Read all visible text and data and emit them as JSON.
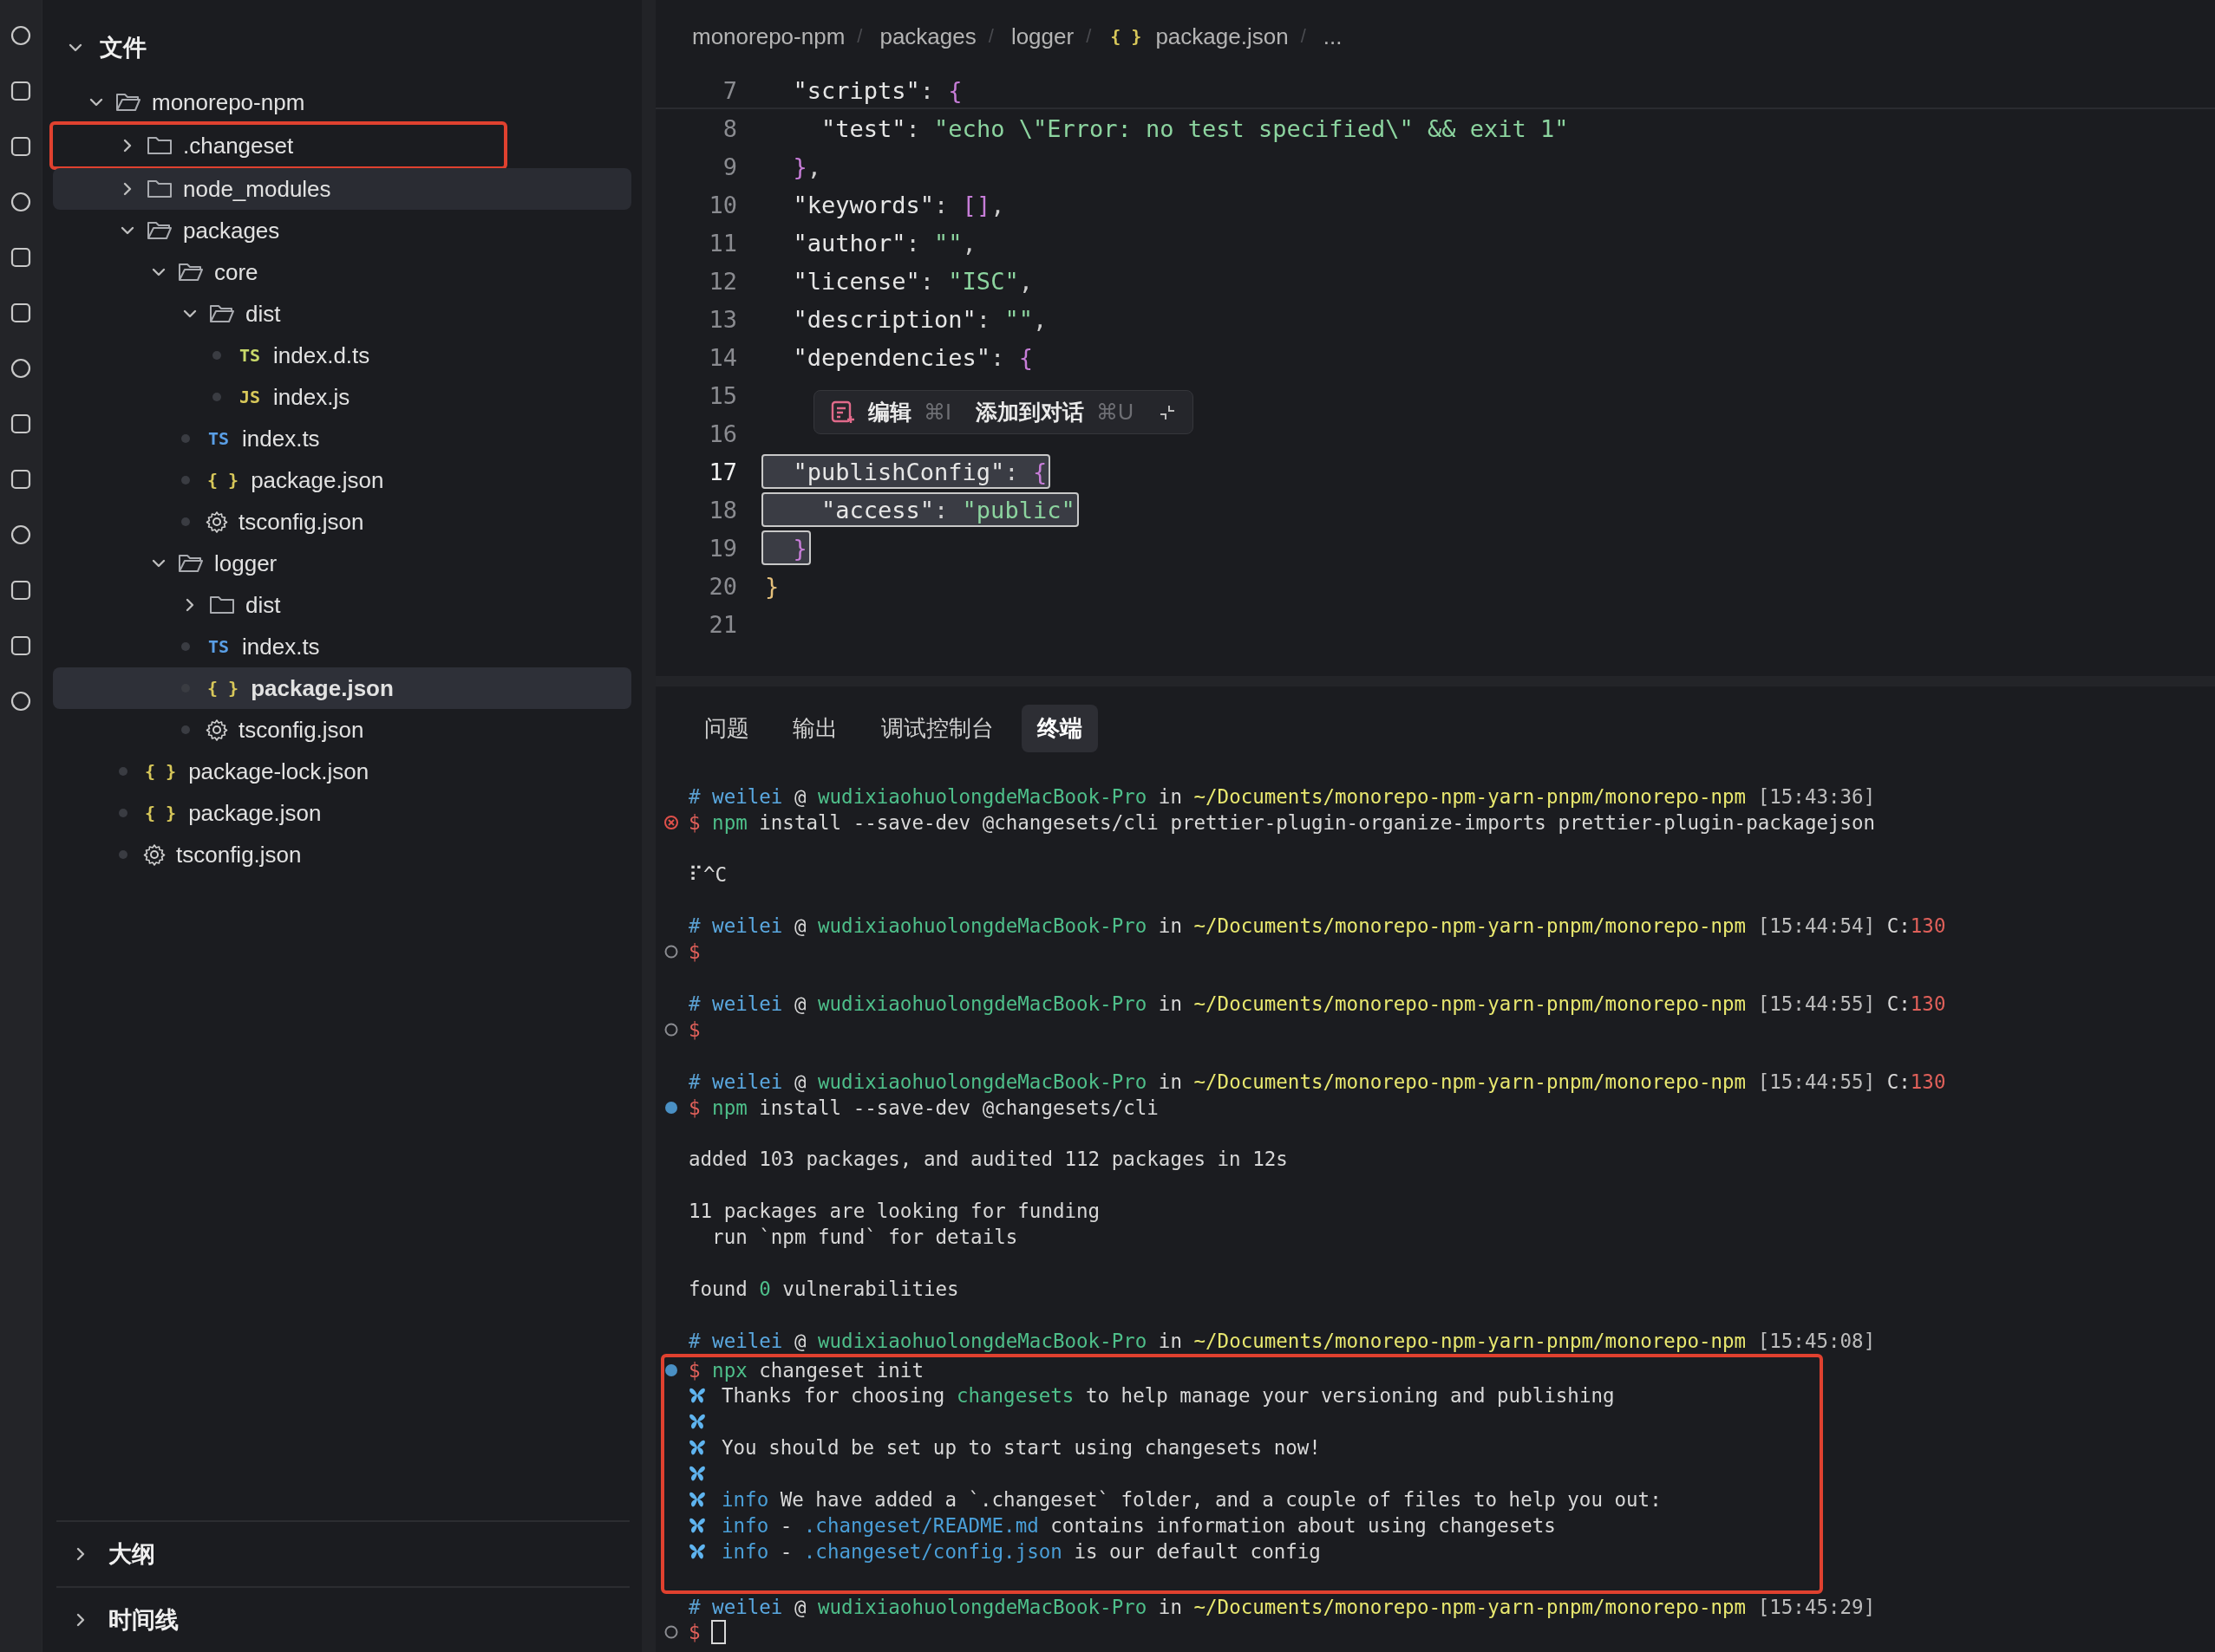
{
  "sidebar": {
    "title": "文件",
    "expanded": true,
    "tree": [
      {
        "label": "monorepo-npm",
        "kind": "folder",
        "expanded": true,
        "selected": false,
        "hovered": false,
        "highlighted": false,
        "children": [
          {
            "label": ".changeset",
            "kind": "folder",
            "expanded": false,
            "selected": false,
            "hovered": false,
            "highlighted": true
          },
          {
            "label": "node_modules",
            "kind": "folder",
            "expanded": false,
            "selected": false,
            "hovered": true,
            "highlighted": false
          },
          {
            "label": "packages",
            "kind": "folder",
            "expanded": true,
            "selected": false,
            "hovered": false,
            "highlighted": false,
            "children": [
              {
                "label": "core",
                "kind": "folder",
                "expanded": true,
                "selected": false,
                "hovered": false,
                "highlighted": false,
                "children": [
                  {
                    "label": "dist",
                    "kind": "folder",
                    "expanded": true,
                    "selected": false,
                    "hovered": false,
                    "highlighted": false,
                    "children": [
                      {
                        "label": "index.d.ts",
                        "kind": "ts-decl",
                        "badge": "TS",
                        "selected": false,
                        "hovered": false,
                        "highlighted": false
                      },
                      {
                        "label": "index.js",
                        "kind": "js",
                        "badge": "JS",
                        "selected": false,
                        "hovered": false,
                        "highlighted": false
                      }
                    ]
                  },
                  {
                    "label": "index.ts",
                    "kind": "ts",
                    "badge": "TS",
                    "selected": false,
                    "hovered": false,
                    "highlighted": false
                  },
                  {
                    "label": "package.json",
                    "kind": "json",
                    "badge": "{ }",
                    "selected": false,
                    "hovered": false,
                    "highlighted": false
                  },
                  {
                    "label": "tsconfig.json",
                    "kind": "config",
                    "selected": false,
                    "hovered": false,
                    "highlighted": false
                  }
                ]
              },
              {
                "label": "logger",
                "kind": "folder",
                "expanded": true,
                "selected": false,
                "hovered": false,
                "highlighted": false,
                "children": [
                  {
                    "label": "dist",
                    "kind": "folder",
                    "expanded": false,
                    "selected": false,
                    "hovered": false,
                    "highlighted": false
                  },
                  {
                    "label": "index.ts",
                    "kind": "ts",
                    "badge": "TS",
                    "selected": false,
                    "hovered": false,
                    "highlighted": false
                  },
                  {
                    "label": "package.json",
                    "kind": "json",
                    "badge": "{ }",
                    "selected": true,
                    "hovered": false,
                    "highlighted": false
                  },
                  {
                    "label": "tsconfig.json",
                    "kind": "config",
                    "selected": false,
                    "hovered": false,
                    "highlighted": false
                  }
                ]
              }
            ]
          },
          {
            "label": "package-lock.json",
            "kind": "json",
            "badge": "{ }",
            "selected": false,
            "hovered": false,
            "highlighted": false
          },
          {
            "label": "package.json",
            "kind": "json",
            "badge": "{ }",
            "selected": false,
            "hovered": false,
            "highlighted": false
          },
          {
            "label": "tsconfig.json",
            "kind": "config",
            "selected": false,
            "hovered": false,
            "highlighted": false
          }
        ]
      }
    ],
    "sections": [
      {
        "title": "大纲",
        "expanded": false
      },
      {
        "title": "时间线",
        "expanded": false
      }
    ]
  },
  "editor": {
    "breadcrumbs": [
      {
        "label": "monorepo-npm",
        "separator": "/"
      },
      {
        "label": "packages",
        "separator": "/"
      },
      {
        "label": "logger",
        "separator": "/"
      },
      {
        "label": "package.json",
        "badge": "{ }",
        "separator": "/"
      },
      {
        "label": "..."
      }
    ],
    "lines": [
      {
        "number": "7",
        "sticky": true,
        "current": false,
        "selected": false,
        "text": "  \"scripts\": {"
      },
      {
        "number": "8",
        "sticky": false,
        "current": false,
        "selected": false,
        "text": "    \"test\": \"echo \\\"Error: no test specified\\\" && exit 1\""
      },
      {
        "number": "9",
        "sticky": false,
        "current": false,
        "selected": false,
        "text": "  },"
      },
      {
        "number": "10",
        "sticky": false,
        "current": false,
        "selected": false,
        "text": "  \"keywords\": [],"
      },
      {
        "number": "11",
        "sticky": false,
        "current": false,
        "selected": false,
        "text": "  \"author\": \"\","
      },
      {
        "number": "12",
        "sticky": false,
        "current": false,
        "selected": false,
        "text": "  \"license\": \"ISC\","
      },
      {
        "number": "13",
        "sticky": false,
        "current": false,
        "selected": false,
        "text": "  \"description\": \"\","
      },
      {
        "number": "14",
        "sticky": false,
        "current": false,
        "selected": false,
        "text": "  \"dependencies\": {"
      },
      {
        "number": "15",
        "sticky": false,
        "current": false,
        "selected": false
      },
      {
        "number": "16",
        "sticky": false,
        "current": false,
        "selected": false
      },
      {
        "number": "17",
        "sticky": false,
        "current": true,
        "selected": true,
        "text": "  \"publishConfig\": {"
      },
      {
        "number": "18",
        "sticky": false,
        "current": false,
        "selected": true,
        "text": "    \"access\": \"public\""
      },
      {
        "number": "19",
        "sticky": false,
        "current": false,
        "selected": true,
        "text": "  }"
      },
      {
        "number": "20",
        "sticky": false,
        "current": false,
        "selected": false,
        "text": "}"
      },
      {
        "number": "21",
        "sticky": false,
        "current": false,
        "selected": false
      }
    ],
    "popup": {
      "actions": [
        {
          "label": "编辑",
          "shortcut": "⌘I"
        },
        {
          "label": "添加到对话",
          "shortcut": "⌘U"
        }
      ]
    }
  },
  "panel": {
    "tabs": [
      {
        "label": "问题",
        "selected": false
      },
      {
        "label": "输出",
        "selected": false
      },
      {
        "label": "调试控制台",
        "selected": false
      },
      {
        "label": "终端",
        "selected": true
      }
    ],
    "terminal": [
      {
        "highlighted": false,
        "lines": [
          {
            "kind": "prompt",
            "hash": "#",
            "user": "weilei",
            "at": "@",
            "host": "wudixiaohuolongdeMacBook-Pro",
            "in": "in",
            "path": "~/Documents/monorepo-npm-yarn-pnpm/monorepo-npm",
            "time": "[15:43:36]"
          },
          {
            "kind": "failed",
            "cursor": false,
            "dollar": "$",
            "program": "npm",
            "args": "install --save-dev @changesets/cli prettier-plugin-organize-imports prettier-plugin-packagejson"
          },
          {
            "kind": "blank"
          },
          {
            "kind": "output",
            "segments": [
              {
                "text": "⠏^C",
                "accent": false
              }
            ]
          },
          {
            "kind": "blank"
          },
          {
            "kind": "prompt",
            "hash": "#",
            "user": "weilei",
            "at": "@",
            "host": "wudixiaohuolongdeMacBook-Pro",
            "in": "in",
            "path": "~/Documents/monorepo-npm-yarn-pnpm/monorepo-npm",
            "time": "[15:44:54]",
            "exit_label": "C:",
            "exit_code": "130"
          },
          {
            "kind": "idle",
            "cursor": false,
            "dollar": "$"
          },
          {
            "kind": "blank"
          },
          {
            "kind": "prompt",
            "hash": "#",
            "user": "weilei",
            "at": "@",
            "host": "wudixiaohuolongdeMacBook-Pro",
            "in": "in",
            "path": "~/Documents/monorepo-npm-yarn-pnpm/monorepo-npm",
            "time": "[15:44:55]",
            "exit_label": "C:",
            "exit_code": "130"
          },
          {
            "kind": "idle",
            "cursor": false,
            "dollar": "$"
          },
          {
            "kind": "blank"
          },
          {
            "kind": "prompt",
            "hash": "#",
            "user": "weilei",
            "at": "@",
            "host": "wudixiaohuolongdeMacBook-Pro",
            "in": "in",
            "path": "~/Documents/monorepo-npm-yarn-pnpm/monorepo-npm",
            "time": "[15:44:55]",
            "exit_label": "C:",
            "exit_code": "130"
          },
          {
            "kind": "done",
            "cursor": false,
            "dollar": "$",
            "program": "npm",
            "args": "install --save-dev @changesets/cli"
          },
          {
            "kind": "blank"
          },
          {
            "kind": "output",
            "segments": [
              {
                "text": "added 103 packages, and audited 112 packages in 12s",
                "accent": false
              }
            ]
          },
          {
            "kind": "blank"
          },
          {
            "kind": "output",
            "segments": [
              {
                "text": "11 packages are looking for funding",
                "accent": false
              }
            ]
          },
          {
            "kind": "output",
            "segments": [
              {
                "text": "  run `npm fund` for details",
                "accent": false
              }
            ]
          },
          {
            "kind": "blank"
          },
          {
            "kind": "output",
            "segments": [
              {
                "text": "found ",
                "accent": false
              },
              {
                "text": "0",
                "accent": true
              },
              {
                "text": " vulnerabilities",
                "accent": false
              }
            ]
          },
          {
            "kind": "blank"
          },
          {
            "kind": "prompt",
            "hash": "#",
            "user": "weilei",
            "at": "@",
            "host": "wudixiaohuolongdeMacBook-Pro",
            "in": "in",
            "path": "~/Documents/monorepo-npm-yarn-pnpm/monorepo-npm",
            "time": "[15:45:08]"
          }
        ]
      },
      {
        "highlighted": true,
        "lines": [
          {
            "kind": "done",
            "cursor": false,
            "dollar": "$",
            "program": "npx",
            "args": "changeset init"
          },
          {
            "kind": "changeset",
            "segments": [
              {
                "text": "Thanks for choosing ",
                "accent": false,
                "link": false
              },
              {
                "text": "changesets",
                "accent": true,
                "link": false
              },
              {
                "text": " to help manage your versioning and publishing",
                "accent": false,
                "link": false
              }
            ]
          },
          {
            "kind": "changeset"
          },
          {
            "kind": "changeset",
            "segments": [
              {
                "text": "You should be set up to start using changesets now!",
                "accent": false,
                "link": false
              }
            ]
          },
          {
            "kind": "changeset"
          },
          {
            "kind": "changeset",
            "tag": "info",
            "segments": [
              {
                "text": "We have added a `.changeset` folder, and a couple of files to help you out:",
                "accent": false,
                "link": false
              }
            ]
          },
          {
            "kind": "changeset",
            "tag": "info",
            "segments": [
              {
                "text": "- ",
                "accent": false,
                "link": false
              },
              {
                "text": ".changeset/README.md",
                "accent": false,
                "link": true
              },
              {
                "text": " contains information about using changesets",
                "accent": false,
                "link": false
              }
            ]
          },
          {
            "kind": "changeset",
            "tag": "info",
            "segments": [
              {
                "text": "- ",
                "accent": false,
                "link": false
              },
              {
                "text": ".changeset/config.json",
                "accent": false,
                "link": true
              },
              {
                "text": " is our default config",
                "accent": false,
                "link": false
              }
            ]
          },
          {
            "kind": "blank"
          }
        ]
      },
      {
        "highlighted": false,
        "lines": [
          {
            "kind": "prompt",
            "hash": "#",
            "user": "weilei",
            "at": "@",
            "host": "wudixiaohuolongdeMacBook-Pro",
            "in": "in",
            "path": "~/Documents/monorepo-npm-yarn-pnpm/monorepo-npm",
            "time": "[15:45:29]"
          },
          {
            "kind": "idle",
            "cursor": true,
            "dollar": "$"
          }
        ]
      }
    ]
  }
}
